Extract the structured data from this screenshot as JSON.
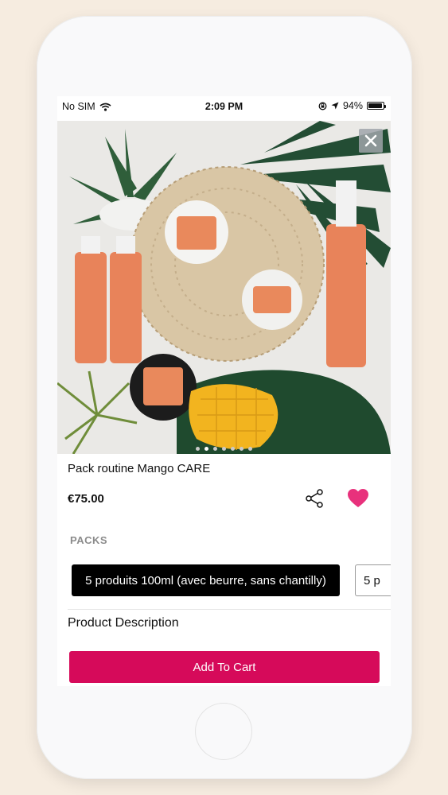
{
  "status_bar": {
    "carrier": "No SIM",
    "time": "2:09 PM",
    "battery": "94%"
  },
  "product": {
    "title": "Pack routine Mango CARE",
    "price": "€75.00",
    "section_label": "PACKS",
    "packs": [
      "5 produits 100ml (avec beurre, sans chantilly)",
      "5 p"
    ],
    "description_label": "Product Description",
    "cart_label": "Add To Cart"
  },
  "gallery": {
    "dot_count": 7,
    "active_index": 1
  },
  "colors": {
    "accent": "#d60a5a",
    "heart": "#e8317c",
    "selected_pack": "#000000"
  },
  "icons": [
    "wifi-icon",
    "rotation-lock-icon",
    "location-arrow-icon",
    "battery-icon",
    "close-icon",
    "share-icon",
    "heart-icon"
  ]
}
